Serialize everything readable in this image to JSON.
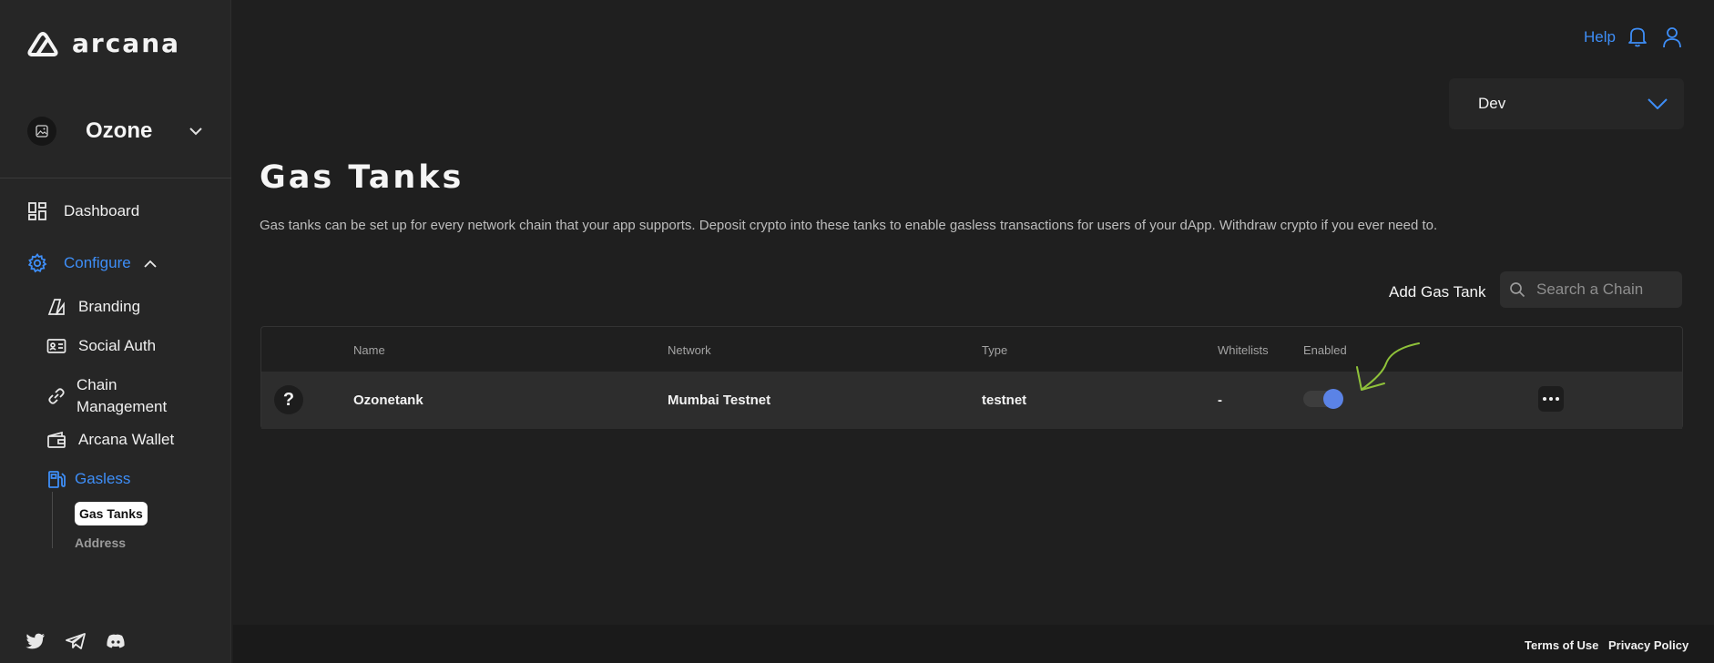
{
  "brand": {
    "name": "arcana",
    "accent": "#3e8ef7"
  },
  "app_selector": {
    "name": "Ozone"
  },
  "sidebar": {
    "items": [
      {
        "label": "Dashboard",
        "icon": "dashboard-icon"
      },
      {
        "label": "Configure",
        "icon": "gear-icon",
        "active": true
      },
      {
        "label": "Branding",
        "icon": "brush-icon"
      },
      {
        "label": "Social Auth",
        "icon": "id-card-icon"
      },
      {
        "label": "Chain",
        "label2": "Management",
        "icon": "link-icon"
      },
      {
        "label": "Arcana Wallet",
        "icon": "wallet-icon"
      },
      {
        "label": "Gasless",
        "icon": "gas-pump-icon",
        "active": true
      }
    ],
    "sub_items": [
      {
        "label": "Gas Tanks",
        "selected": true
      },
      {
        "label": "Address"
      }
    ],
    "socials": [
      "twitter-icon",
      "telegram-icon",
      "discord-icon"
    ]
  },
  "header": {
    "help_label": "Help",
    "environment": "Dev"
  },
  "main": {
    "title": "Gas Tanks",
    "description": "Gas tanks can be set up for every network chain that your app supports. Deposit crypto into these tanks to enable gasless transactions for users of your dApp. Withdraw crypto if you ever need to.",
    "add_button": "Add Gas Tank",
    "search_placeholder": "Search a Chain"
  },
  "table": {
    "columns": [
      "Name",
      "Network",
      "Type",
      "Whitelists",
      "Enabled"
    ],
    "rows": [
      {
        "icon_glyph": "?",
        "name": "Ozonetank",
        "network": "Mumbai Testnet",
        "type": "testnet",
        "whitelists": "-",
        "enabled": true
      }
    ]
  },
  "footer": {
    "terms": "Terms of Use",
    "privacy": "Privacy Policy"
  }
}
